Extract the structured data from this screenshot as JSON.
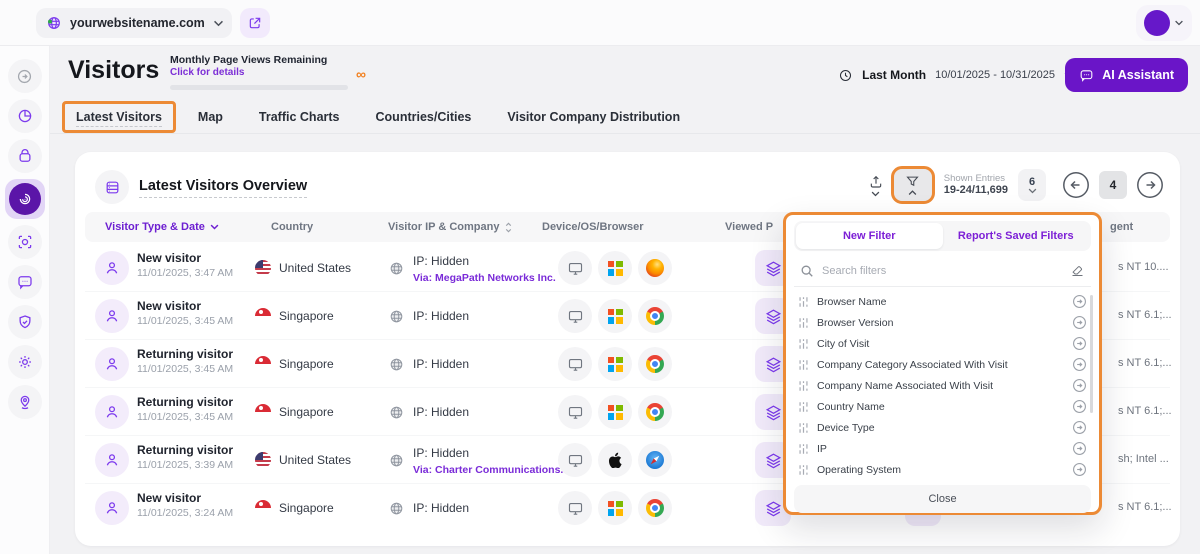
{
  "topbar": {
    "site": "yourwebsitename.com"
  },
  "header": {
    "title": "Visitors",
    "quota_label": "Monthly Page Views Remaining",
    "quota_link": "Click for details",
    "infinity": "∞",
    "period_label": "Last Month",
    "date_range": "10/01/2025 - 10/31/2025",
    "ai_label": "AI Assistant"
  },
  "tabs": [
    {
      "label": "Latest Visitors",
      "active": true
    },
    {
      "label": "Map",
      "active": false
    },
    {
      "label": "Traffic Charts",
      "active": false
    },
    {
      "label": "Countries/Cities",
      "active": false
    },
    {
      "label": "Visitor Company Distribution",
      "active": false
    }
  ],
  "table": {
    "title": "Latest Visitors Overview",
    "toolbar": {
      "shown_label": "Shown Entries",
      "shown_value": "19-24/11,699",
      "page_size": "6",
      "page": "4"
    },
    "columns": [
      "Visitor Type & Date",
      "Country",
      "Visitor IP & Company",
      "Device/OS/Browser",
      "Viewed P",
      "gent"
    ],
    "rows": [
      {
        "type": "New visitor",
        "datetime": "11/01/2025, 3:47 AM",
        "country": "United States",
        "flag": "us",
        "ip": "IP: Hidden",
        "via": "Via: MegaPath Networks Inc.",
        "device": "desktop",
        "os": "windows",
        "browser": "firefox",
        "agent": "s NT 10...."
      },
      {
        "type": "New visitor",
        "datetime": "11/01/2025, 3:45 AM",
        "country": "Singapore",
        "flag": "sg",
        "ip": "IP: Hidden",
        "via": "",
        "device": "desktop",
        "os": "windows",
        "browser": "chrome",
        "agent": "s NT 6.1;..."
      },
      {
        "type": "Returning visitor",
        "datetime": "11/01/2025, 3:45 AM",
        "country": "Singapore",
        "flag": "sg",
        "ip": "IP: Hidden",
        "via": "",
        "device": "desktop",
        "os": "windows",
        "browser": "chrome",
        "agent": "s NT 6.1;..."
      },
      {
        "type": "Returning visitor",
        "datetime": "11/01/2025, 3:45 AM",
        "country": "Singapore",
        "flag": "sg",
        "ip": "IP: Hidden",
        "via": "",
        "device": "desktop",
        "os": "windows",
        "browser": "chrome",
        "agent": "s NT 6.1;..."
      },
      {
        "type": "Returning visitor",
        "datetime": "11/01/2025, 3:39 AM",
        "country": "United States",
        "flag": "us",
        "ip": "IP: Hidden",
        "via": "Via: Charter Communications...",
        "device": "desktop",
        "os": "apple",
        "browser": "safari",
        "agent": "sh; Intel ..."
      },
      {
        "type": "New visitor",
        "datetime": "11/01/2025, 3:24 AM",
        "country": "Singapore",
        "flag": "sg",
        "ip": "IP: Hidden",
        "via": "",
        "device": "desktop",
        "os": "windows",
        "browser": "chrome",
        "agent": "s NT 6.1;..."
      }
    ]
  },
  "filter_panel": {
    "tabs": [
      "New Filter",
      "Report's Saved Filters"
    ],
    "search_placeholder": "Search filters",
    "items": [
      "Browser Name",
      "Browser Version",
      "City of Visit",
      "Company Category Associated With Visit",
      "Company Name Associated With Visit",
      "Country Name",
      "Device Type",
      "IP",
      "Operating System"
    ],
    "close_label": "Close"
  },
  "colors": {
    "accent": "#7C3AED",
    "deep_purple": "#5B15A8",
    "ai_button": "#6A15C8",
    "annotation_orange": "#EC8A35",
    "infinity_orange": "#F2801F"
  }
}
